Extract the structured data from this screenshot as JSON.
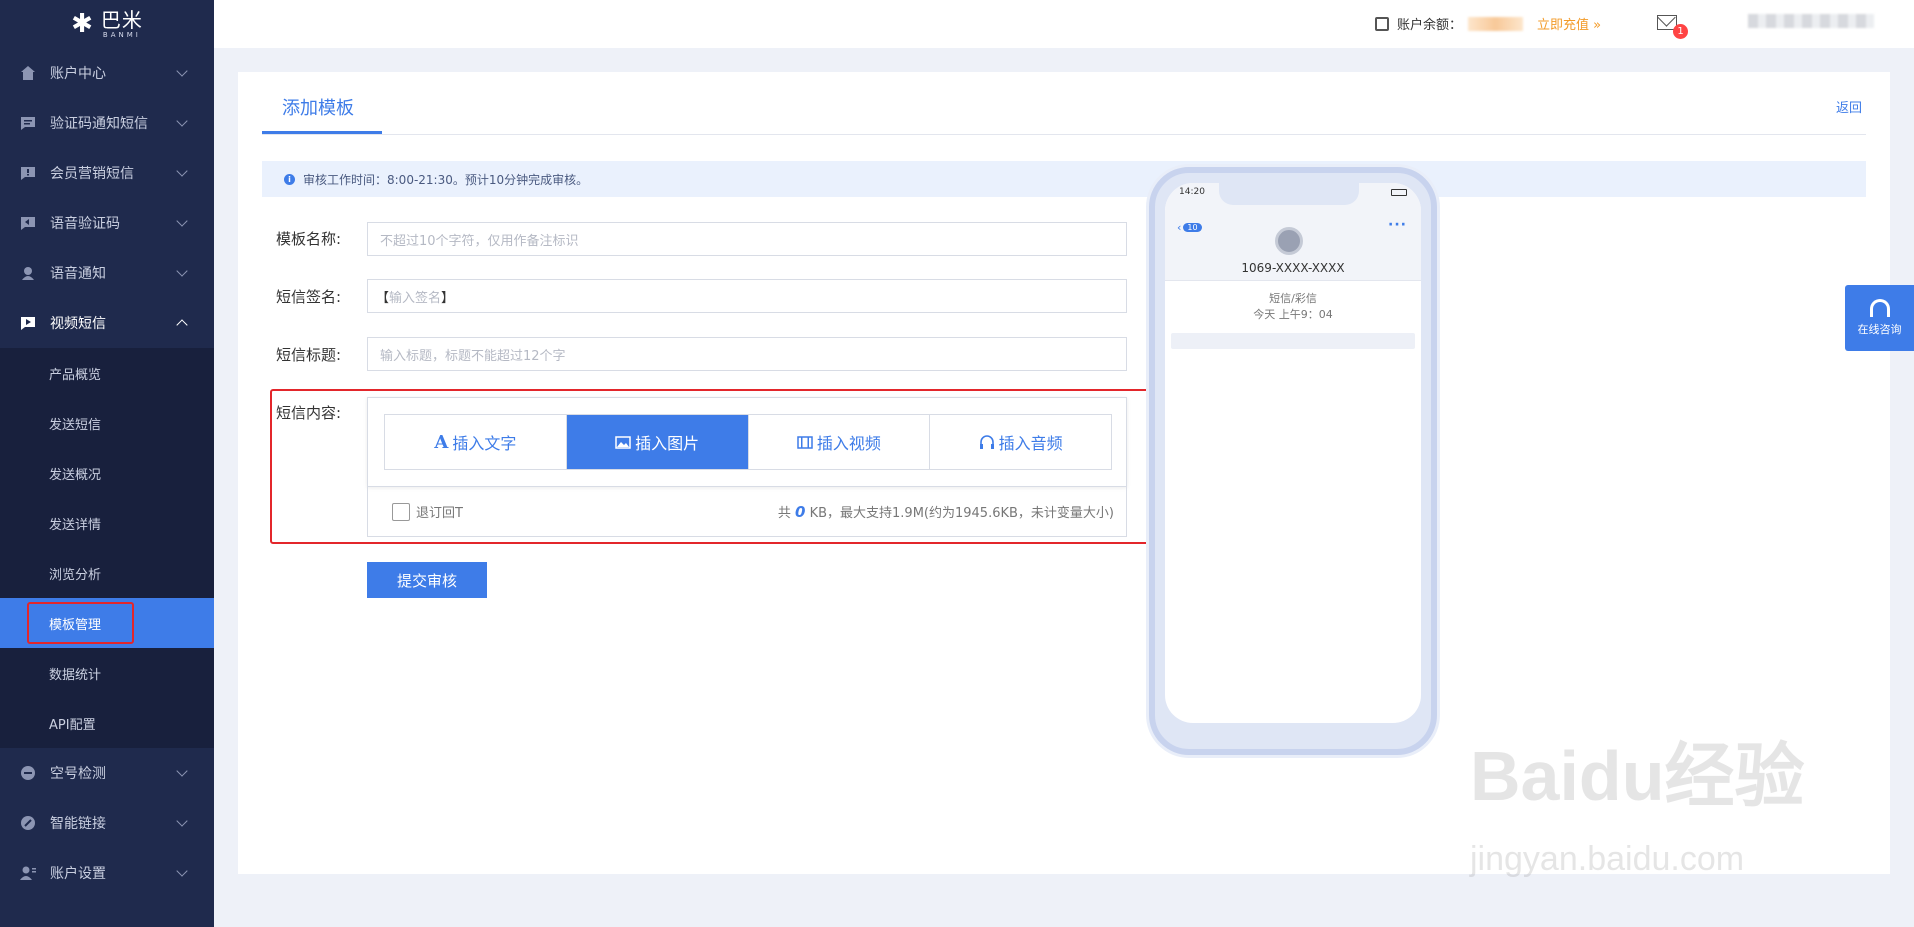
{
  "brand": {
    "name": "巴米",
    "sub": "BANMI"
  },
  "topbar": {
    "balance_label": "账户余额：",
    "recharge": "立即充值 »",
    "mail_count": "1"
  },
  "sidebar": {
    "items": [
      {
        "label": "账户中心",
        "icon": "home-icon"
      },
      {
        "label": "验证码通知短信",
        "icon": "message-icon"
      },
      {
        "label": "会员营销短信",
        "icon": "marketing-icon"
      },
      {
        "label": "语音验证码",
        "icon": "voice-code-icon"
      },
      {
        "label": "语音通知",
        "icon": "voice-notify-icon"
      },
      {
        "label": "视频短信",
        "icon": "video-sms-icon",
        "open": true
      },
      {
        "label": "空号检测",
        "icon": "detect-icon"
      },
      {
        "label": "智能链接",
        "icon": "link-icon"
      },
      {
        "label": "账户设置",
        "icon": "user-settings-icon"
      }
    ],
    "sub_items": [
      "产品概览",
      "发送短信",
      "发送概况",
      "发送详情",
      "浏览分析",
      "模板管理",
      "数据统计",
      "API配置"
    ],
    "active_sub": "模板管理"
  },
  "page": {
    "tab": "添加模板",
    "back": "返回",
    "notice": "审核工作时间：8:00-21:30。预计10分钟完成审核。",
    "fields": {
      "name_label": "模板名称:",
      "name_placeholder": "不超过10个字符，仅用作备注标识",
      "sign_label": "短信签名:",
      "sign_open": "【",
      "sign_placeholder": "输入签名",
      "sign_close": "】",
      "title_label": "短信标题:",
      "title_placeholder": "输入标题，标题不能超过12个字",
      "content_label": "短信内容:"
    },
    "insert_buttons": [
      "插入文字",
      "插入图片",
      "插入视频",
      "插入音频"
    ],
    "unsubscribe": "退订回T",
    "size_prefix": "共",
    "size_value": "0",
    "size_suffix": "KB，最大支持1.9M(约为1945.6KB，未计变量大小)",
    "submit": "提交审核"
  },
  "phone": {
    "time": "14:20",
    "back_count": "10",
    "number": "1069-XXXX-XXXX",
    "type": "短信/彩信",
    "date": "今天 上午9：04"
  },
  "consult": "在线咨询",
  "watermark": {
    "line1": "Baidu经验",
    "line2": "jingyan.baidu.com"
  },
  "colors": {
    "sidebar": "#1f2a4d",
    "accent": "#3e7ce8",
    "highlight": "#e3262b",
    "recharge": "#f39b28"
  }
}
